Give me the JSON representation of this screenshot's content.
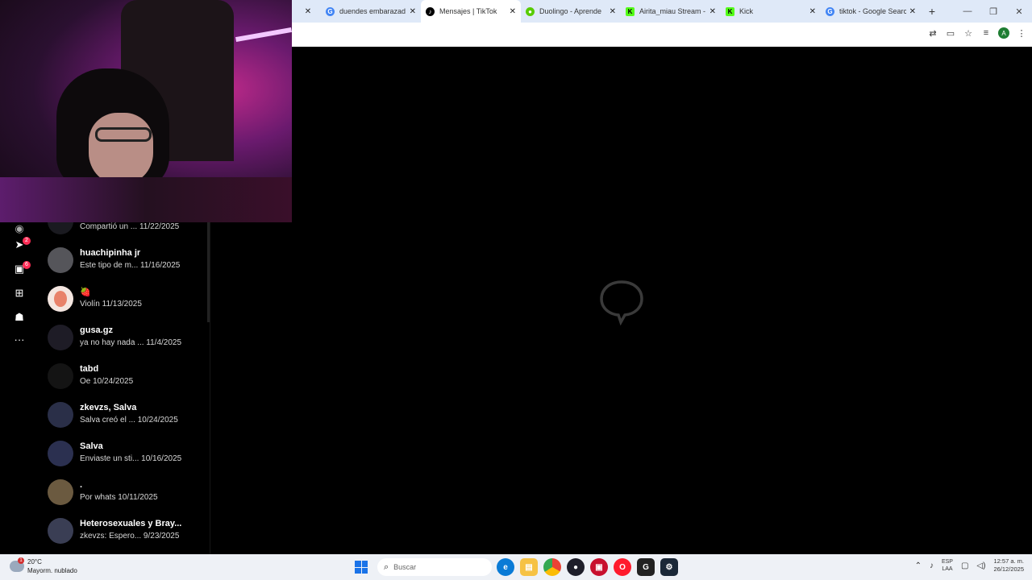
{
  "browser": {
    "tabs": [
      {
        "label": "duendes embarazad",
        "favicon": "google-icon",
        "color": "#4285f4",
        "active": false
      },
      {
        "label": "Mensajes | TikTok",
        "favicon": "tiktok-icon",
        "color": "#000000",
        "active": true
      },
      {
        "label": "Duolingo - Aprende",
        "favicon": "duolingo-icon",
        "color": "#58cc02",
        "active": false
      },
      {
        "label": "Airita_miau Stream -",
        "favicon": "kick-icon",
        "color": "#53fc18",
        "active": false
      },
      {
        "label": "Kick",
        "favicon": "kick-icon",
        "color": "#53fc18",
        "active": false
      },
      {
        "label": "tiktok - Google Searc",
        "favicon": "google-icon",
        "color": "#4285f4",
        "active": false
      }
    ],
    "new_tab": "+",
    "close_glyph": "✕",
    "profile_initial": "A"
  },
  "rail": {
    "badges": {
      "activity": "2",
      "messages": "6"
    }
  },
  "conversations": [
    {
      "name": "",
      "preview": "Compartió un ...",
      "date": "11/22/2025"
    },
    {
      "name": "huachipinha jr",
      "preview": "Este tipo de m...",
      "date": "11/16/2025"
    },
    {
      "name": "🍓",
      "preview": "Violín",
      "date": "11/13/2025"
    },
    {
      "name": "gusa.gz",
      "preview": "ya no hay nada ...",
      "date": "11/4/2025"
    },
    {
      "name": "tabd",
      "preview": "Oe",
      "date": "10/24/2025"
    },
    {
      "name": "zkevzs, Salva",
      "preview": "Salva creó el ...",
      "date": "10/24/2025"
    },
    {
      "name": "Salva",
      "preview": "Enviaste un sti...",
      "date": "10/16/2025"
    },
    {
      "name": ".",
      "preview": "Por whats",
      "date": "10/11/2025"
    },
    {
      "name": "Heterosexuales y Bray...",
      "preview": "zkevzs: Espero...",
      "date": "9/23/2025"
    }
  ],
  "taskbar": {
    "weather_temp": "20°C",
    "weather_desc": "Mayorm. nublado",
    "search_placeholder": "Buscar",
    "lang_top": "ESP",
    "lang_bottom": "LAA",
    "time": "12:57 a. m.",
    "date": "26/12/2025"
  }
}
